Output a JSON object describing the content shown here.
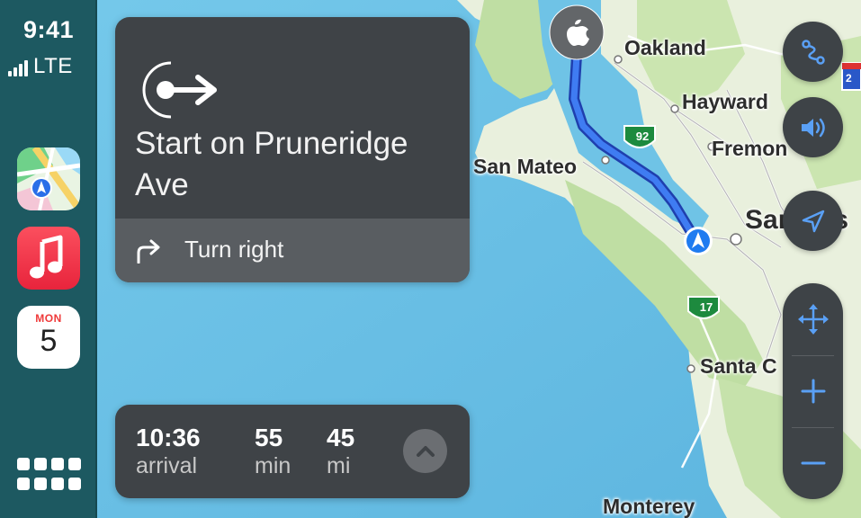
{
  "status": {
    "time": "9:41",
    "network": "LTE"
  },
  "sidebar": {
    "apps": [
      {
        "name": "Maps"
      },
      {
        "name": "Music"
      },
      {
        "name": "Calendar",
        "day": "MON",
        "date": "5"
      }
    ]
  },
  "navigation": {
    "instruction": "Start on Pruneridge Ave",
    "next_step": "Turn right"
  },
  "trip": {
    "arrival_time": "10:36",
    "arrival_label": "arrival",
    "duration_value": "55",
    "duration_unit": "min",
    "distance_value": "45",
    "distance_unit": "mi"
  },
  "map": {
    "labels": {
      "oakland": "Oakland",
      "hayward": "Hayward",
      "fremont": "Fremon",
      "san_mateo": "San Mateo",
      "san_jose": "San Jos",
      "santa_cruz": "Santa C",
      "monterey": "Monterey",
      "hwy92": "92",
      "hwy17": "17",
      "hwy_top": "2"
    },
    "colors": {
      "water": "#6fc3e6",
      "land": "#e8f1dc",
      "route": "#2f63e0",
      "park": "#b9dc9a"
    }
  },
  "controls": {
    "icons": [
      "route-overview-icon",
      "speaker-icon",
      "location-arrow-icon",
      "pan-icon",
      "zoom-in-icon",
      "zoom-out-icon"
    ]
  }
}
